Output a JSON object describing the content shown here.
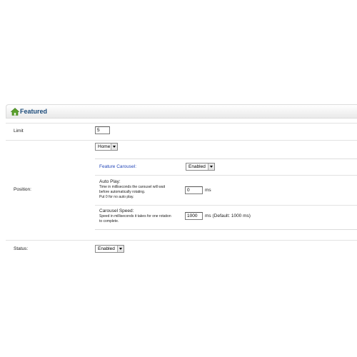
{
  "panel": {
    "title": "Featured",
    "icon": "home-icon",
    "icon_color": "#5aa02c"
  },
  "form": {
    "limit": {
      "label": "Limit",
      "value": "5"
    },
    "position": {
      "label": "Position:",
      "selected": "Home",
      "feature_carousel": {
        "label": "Feature Carousel:",
        "selected": "Enabled"
      },
      "auto_play": {
        "label": "Auto Play:",
        "help_line1": "Time in milliseconds the carousel will wait",
        "help_line2": "before automatically rotating.",
        "help_line3": "Put 0 for no auto play.",
        "value": "0",
        "unit": "ms"
      },
      "carousel_speed": {
        "label": "Carousel Speed:",
        "help_line1": "Speed in milliseconds it takes for one rotation",
        "help_line2": "to complete.",
        "value": "1000",
        "unit": "ms (Default: 1000 ms)"
      }
    },
    "status": {
      "label": "Status:",
      "selected": "Enabled"
    }
  }
}
